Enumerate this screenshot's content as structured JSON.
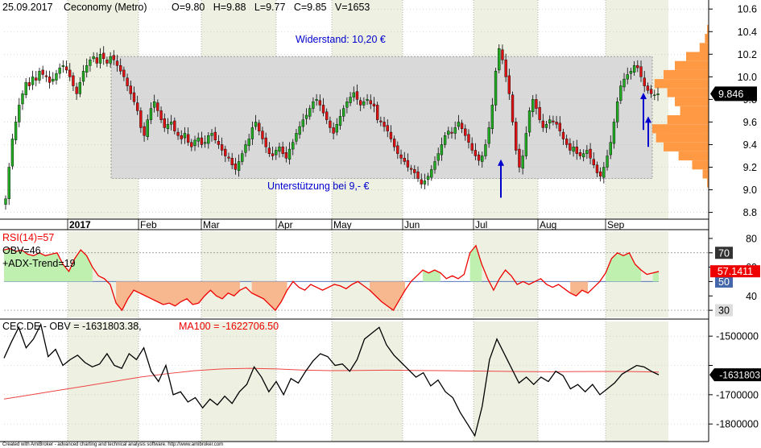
{
  "header": {
    "date": "25.09.2017",
    "symbol_name": "Ceconomy (Metro)",
    "ohlcv": "O=9.80   H=9.88   L=9.77   C=9.85   V=1653"
  },
  "annotations": {
    "resistance": "Widerstand: 10,20 €",
    "support": "Unterstützung bei 9,- €"
  },
  "colors": {
    "up": "#22aa22",
    "down": "#dd1111",
    "zone": "#d9d9d9",
    "volume_profile": "#ff9944",
    "rsi": "#ee0000",
    "obv": "#000000",
    "ma": "#ee4444",
    "arrow": "#0000cc"
  },
  "price_panel": {
    "current_price_label": "9.846",
    "months": [
      "2017",
      "Feb",
      "Mar",
      "Apr",
      "May",
      "Jun",
      "Jul",
      "Aug",
      "Sep"
    ],
    "y_ticks": [
      "10.6",
      "10.4",
      "10.2",
      "10.0",
      "9.8",
      "9.6",
      "9.4",
      "9.2",
      "9.0",
      "8.8"
    ]
  },
  "rsi_panel": {
    "label_rsi": "RSI(14)=57",
    "label_obv": "OBV=46",
    "label_adx": "+ADX-Trend=19",
    "value_label": "57.1411",
    "y_ticks": [
      "80",
      "70",
      "60",
      "50",
      "40",
      "30"
    ],
    "box_70": "70",
    "box_50": "50",
    "box_30": "30"
  },
  "obv_panel": {
    "label_main": "CEC.DE - OBV = -1631803.38,",
    "label_ma": "MA100 = -1622706.50",
    "value_label": "-1631803",
    "y_ticks": [
      "-1500000",
      "-1600000",
      "-1700000",
      "-1800000"
    ]
  },
  "footer": "Created with AmiBroker - advanced charting and technical analysis software. http://www.amibroker.com",
  "chart_data": [
    {
      "type": "candlestick",
      "title": "25.09.2017 Ceconomy (Metro)",
      "ylim": [
        8.74,
        10.68
      ],
      "x_range": [
        "2017-01-02",
        "2017-09-25"
      ],
      "resistance": 10.2,
      "support": 9.0,
      "zone": [
        9.1,
        10.18
      ],
      "last": {
        "open": 9.8,
        "high": 9.88,
        "low": 9.77,
        "close": 9.85,
        "volume": 1653
      },
      "closes": [
        8.92,
        9.2,
        9.45,
        9.6,
        9.75,
        9.85,
        9.95,
        9.92,
        10.0,
        9.97,
        10.05,
        10.02,
        10.0,
        9.95,
        9.98,
        10.03,
        10.08,
        10.1,
        10.06,
        10.0,
        9.92,
        9.85,
        9.95,
        10.05,
        10.1,
        10.15,
        10.18,
        10.12,
        10.2,
        10.16,
        10.12,
        10.18,
        10.15,
        10.1,
        10.05,
        10.0,
        9.92,
        9.85,
        9.78,
        9.7,
        9.55,
        9.48,
        9.62,
        9.72,
        9.78,
        9.7,
        9.62,
        9.55,
        9.58,
        9.6,
        9.52,
        9.48,
        9.45,
        9.5,
        9.42,
        9.38,
        9.44,
        9.46,
        9.4,
        9.42,
        9.48,
        9.5,
        9.44,
        9.4,
        9.35,
        9.3,
        9.28,
        9.22,
        9.18,
        9.25,
        9.32,
        9.4,
        9.45,
        9.55,
        9.6,
        9.52,
        9.45,
        9.38,
        9.32,
        9.3,
        9.35,
        9.38,
        9.32,
        9.28,
        9.36,
        9.42,
        9.5,
        9.56,
        9.62,
        9.66,
        9.72,
        9.78,
        9.8,
        9.75,
        9.68,
        9.62,
        9.55,
        9.5,
        9.58,
        9.65,
        9.72,
        9.78,
        9.82,
        9.86,
        9.8,
        9.75,
        9.78,
        9.8,
        9.76,
        9.74,
        9.62,
        9.6,
        9.56,
        9.52,
        9.45,
        9.38,
        9.32,
        9.28,
        9.25,
        9.2,
        9.18,
        9.15,
        9.1,
        9.05,
        9.08,
        9.12,
        9.18,
        9.25,
        9.32,
        9.4,
        9.48,
        9.52,
        9.5,
        9.55,
        9.6,
        9.54,
        9.48,
        9.42,
        9.35,
        9.3,
        9.26,
        9.3,
        9.4,
        9.55,
        9.75,
        10.05,
        10.25,
        10.15,
        10.0,
        9.85,
        9.6,
        9.35,
        9.2,
        9.3,
        9.5,
        9.7,
        9.8,
        9.72,
        9.62,
        9.55,
        9.58,
        9.62,
        9.6,
        9.58,
        9.52,
        9.45,
        9.4,
        9.35,
        9.38,
        9.32,
        9.3,
        9.32,
        9.35,
        9.28,
        9.22,
        9.15,
        9.12,
        9.2,
        9.3,
        9.42,
        9.6,
        9.78,
        9.92,
        9.98,
        10.02,
        10.05,
        10.1,
        10.08,
        10.0,
        9.92,
        9.88,
        9.85,
        9.84,
        9.85
      ]
    },
    {
      "type": "horizontal-bar",
      "name": "volume-profile",
      "y": [
        9.06,
        9.14,
        9.22,
        9.3,
        9.38,
        9.46,
        9.54,
        9.62,
        9.7,
        9.78,
        9.86,
        9.94,
        10.02,
        10.1,
        10.18,
        10.26,
        10.34,
        10.42
      ],
      "values": [
        2,
        8,
        22,
        40,
        60,
        70,
        75,
        55,
        38,
        45,
        55,
        72,
        60,
        45,
        30,
        12,
        5,
        2
      ]
    },
    {
      "type": "line",
      "title": "RSI(14)=57",
      "ylim": [
        25,
        85
      ],
      "levels": [
        70,
        50,
        30
      ],
      "last": 57.1411,
      "values": [
        72,
        73,
        71,
        72,
        69,
        68,
        70,
        68,
        69,
        70,
        62,
        57,
        66,
        72,
        68,
        60,
        54,
        52,
        48,
        35,
        30,
        38,
        44,
        42,
        40,
        38,
        36,
        34,
        35,
        33,
        36,
        38,
        34,
        35,
        40,
        44,
        40,
        38,
        42,
        40,
        44,
        46,
        42,
        40,
        38,
        34,
        30,
        36,
        44,
        50,
        46,
        44,
        48,
        46,
        44,
        46,
        48,
        47,
        45,
        48,
        50,
        47,
        44,
        40,
        36,
        33,
        30,
        37,
        44,
        50,
        54,
        58,
        56,
        58,
        56,
        52,
        54,
        52,
        55,
        70,
        75,
        62,
        52,
        44,
        52,
        58,
        54,
        48,
        50,
        48,
        50,
        52,
        48,
        46,
        48,
        45,
        42,
        40,
        44,
        42,
        46,
        50,
        56,
        66,
        70,
        68,
        70,
        62,
        58,
        55,
        56,
        57
      ]
    },
    {
      "type": "line",
      "title": "CEC.DE - OBV = -1631803.38, MA100 = -1622706.50",
      "ylim": [
        -1860000,
        -1450000
      ],
      "series": [
        {
          "name": "OBV",
          "values": [
            -1575000,
            -1520000,
            -1470000,
            -1540000,
            -1510000,
            -1460000,
            -1570000,
            -1545000,
            -1600000,
            -1580000,
            -1565000,
            -1590000,
            -1605000,
            -1595000,
            -1560000,
            -1600000,
            -1610000,
            -1560000,
            -1580000,
            -1540000,
            -1620000,
            -1655000,
            -1600000,
            -1700000,
            -1690000,
            -1725000,
            -1710000,
            -1745000,
            -1715000,
            -1735000,
            -1705000,
            -1730000,
            -1690000,
            -1665000,
            -1605000,
            -1640000,
            -1690000,
            -1655000,
            -1700000,
            -1645000,
            -1660000,
            -1620000,
            -1585000,
            -1560000,
            -1570000,
            -1600000,
            -1595000,
            -1620000,
            -1580000,
            -1510000,
            -1490000,
            -1470000,
            -1530000,
            -1565000,
            -1590000,
            -1615000,
            -1640000,
            -1625000,
            -1670000,
            -1650000,
            -1690000,
            -1710000,
            -1760000,
            -1800000,
            -1840000,
            -1740000,
            -1580000,
            -1510000,
            -1560000,
            -1610000,
            -1660000,
            -1640000,
            -1665000,
            -1640000,
            -1655000,
            -1620000,
            -1635000,
            -1680000,
            -1665000,
            -1690000,
            -1665000,
            -1700000,
            -1680000,
            -1660000,
            -1630000,
            -1615000,
            -1600000,
            -1605000,
            -1620000,
            -1632000
          ]
        },
        {
          "name": "MA100",
          "values": [
            -1715000,
            -1700000,
            -1685000,
            -1670000,
            -1655000,
            -1640000,
            -1628000,
            -1618000,
            -1612000,
            -1610000,
            -1612000,
            -1616000,
            -1618000,
            -1617000,
            -1616000,
            -1617000,
            -1618000,
            -1619000,
            -1620000,
            -1621000,
            -1621500,
            -1621000,
            -1620500,
            -1621000,
            -1622700
          ]
        }
      ]
    }
  ]
}
